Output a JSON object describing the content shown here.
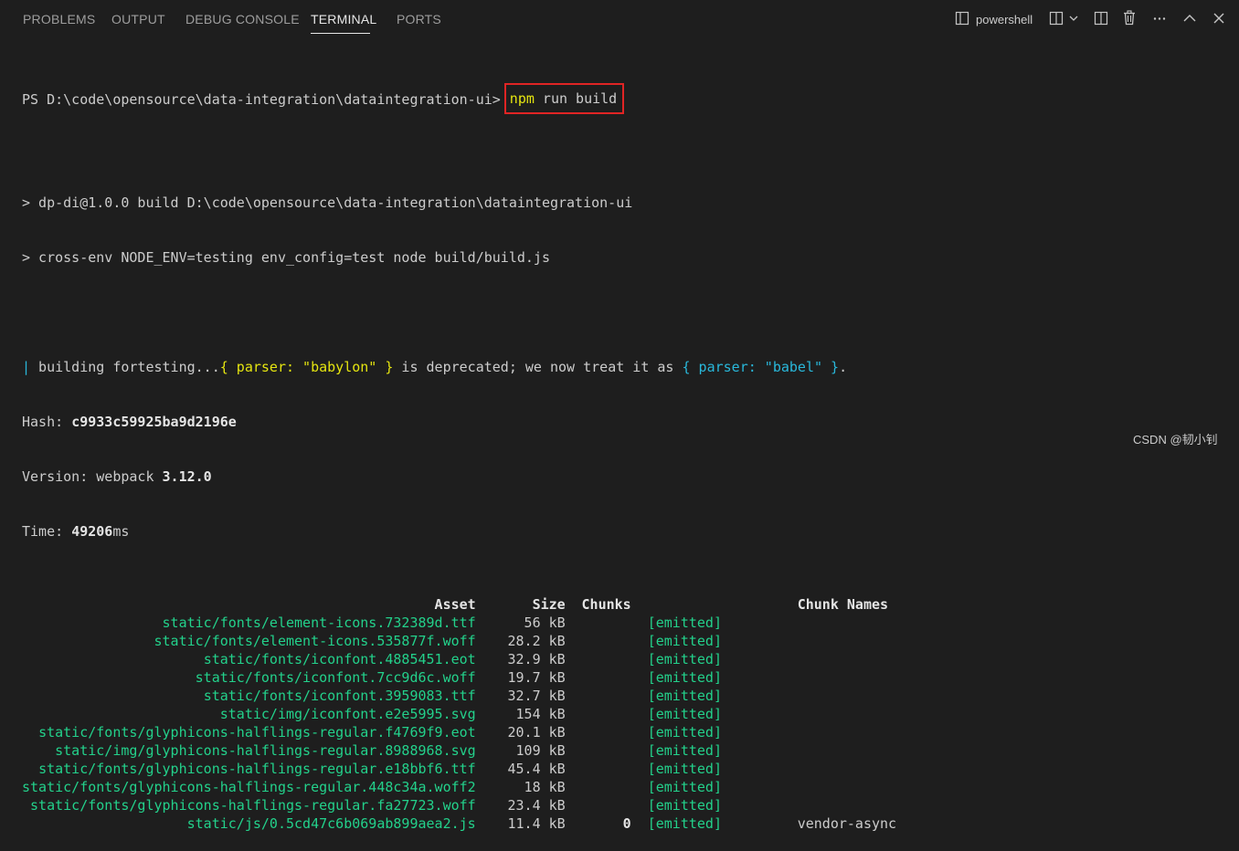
{
  "panel": {
    "tabs": [
      {
        "label": "PROBLEMS"
      },
      {
        "label": "OUTPUT"
      },
      {
        "label": "DEBUG CONSOLE"
      },
      {
        "label": "TERMINAL"
      },
      {
        "label": "PORTS"
      }
    ],
    "active_tab": "TERMINAL",
    "shell_label": "powershell",
    "icons": [
      "terminal-panel-icon",
      "split-terminal-icon",
      "chevron-down-icon",
      "split-editor-icon",
      "trash-icon",
      "more-icon",
      "chevron-up-icon",
      "close-icon"
    ]
  },
  "terminal": {
    "prompt": "PS D:\\code\\opensource\\data-integration\\dataintegration-ui>",
    "command_npm": "npm",
    "command_rest": " run build",
    "script_line1": "> dp-di@1.0.0 build D:\\code\\opensource\\data-integration\\dataintegration-ui",
    "script_line2": "> cross-env NODE_ENV=testing env_config=test node build/build.js",
    "warn_bar": "|",
    "warn_building": " building fortesting...",
    "warn_parser1": "{ parser: \"babylon\" }",
    "warn_mid": " is deprecated; we now treat it as ",
    "warn_parser2": "{ parser: \"babel\" }",
    "warn_end": ".",
    "hash_label": "Hash: ",
    "hash_value": "c9933c59925ba9d2196e",
    "version_label": "Version: webpack ",
    "version_value": "3.12.0",
    "time_label": "Time: ",
    "time_value": "49206",
    "time_unit": "ms",
    "headers": {
      "asset": "Asset",
      "size": "Size",
      "chunks": "Chunks",
      "chunk_names": "Chunk Names"
    },
    "assets": [
      {
        "asset": "static/fonts/element-icons.732389d.ttf",
        "size": "56 kB",
        "chunks": "",
        "status": "[emitted]",
        "name": ""
      },
      {
        "asset": "static/fonts/element-icons.535877f.woff",
        "size": "28.2 kB",
        "chunks": "",
        "status": "[emitted]",
        "name": ""
      },
      {
        "asset": "static/fonts/iconfont.4885451.eot",
        "size": "32.9 kB",
        "chunks": "",
        "status": "[emitted]",
        "name": ""
      },
      {
        "asset": "static/fonts/iconfont.7cc9d6c.woff",
        "size": "19.7 kB",
        "chunks": "",
        "status": "[emitted]",
        "name": ""
      },
      {
        "asset": "static/fonts/iconfont.3959083.ttf",
        "size": "32.7 kB",
        "chunks": "",
        "status": "[emitted]",
        "name": ""
      },
      {
        "asset": "static/img/iconfont.e2e5995.svg",
        "size": "154 kB",
        "chunks": "",
        "status": "[emitted]",
        "name": ""
      },
      {
        "asset": "static/fonts/glyphicons-halflings-regular.f4769f9.eot",
        "size": "20.1 kB",
        "chunks": "",
        "status": "[emitted]",
        "name": ""
      },
      {
        "asset": "static/img/glyphicons-halflings-regular.8988968.svg",
        "size": "109 kB",
        "chunks": "",
        "status": "[emitted]",
        "name": ""
      },
      {
        "asset": "static/fonts/glyphicons-halflings-regular.e18bbf6.ttf",
        "size": "45.4 kB",
        "chunks": "",
        "status": "[emitted]",
        "name": ""
      },
      {
        "asset": "static/fonts/glyphicons-halflings-regular.448c34a.woff2",
        "size": "18 kB",
        "chunks": "",
        "status": "[emitted]",
        "name": ""
      },
      {
        "asset": "static/fonts/glyphicons-halflings-regular.fa27723.woff",
        "size": "23.4 kB",
        "chunks": "",
        "status": "[emitted]",
        "name": ""
      },
      {
        "asset": "static/js/0.5cd47c6b069ab899aea2.js",
        "size": "11.4 kB",
        "chunks": "0",
        "status": "[emitted]",
        "name": "vendor-async"
      }
    ]
  },
  "watermark": "CSDN @韧小钊",
  "colors": {
    "background": "#1e1e1e",
    "text": "#cccccc",
    "green": "#23d18b",
    "yellow": "#e5e510",
    "cyan": "#29b8db",
    "highlight_border": "#e02424"
  }
}
